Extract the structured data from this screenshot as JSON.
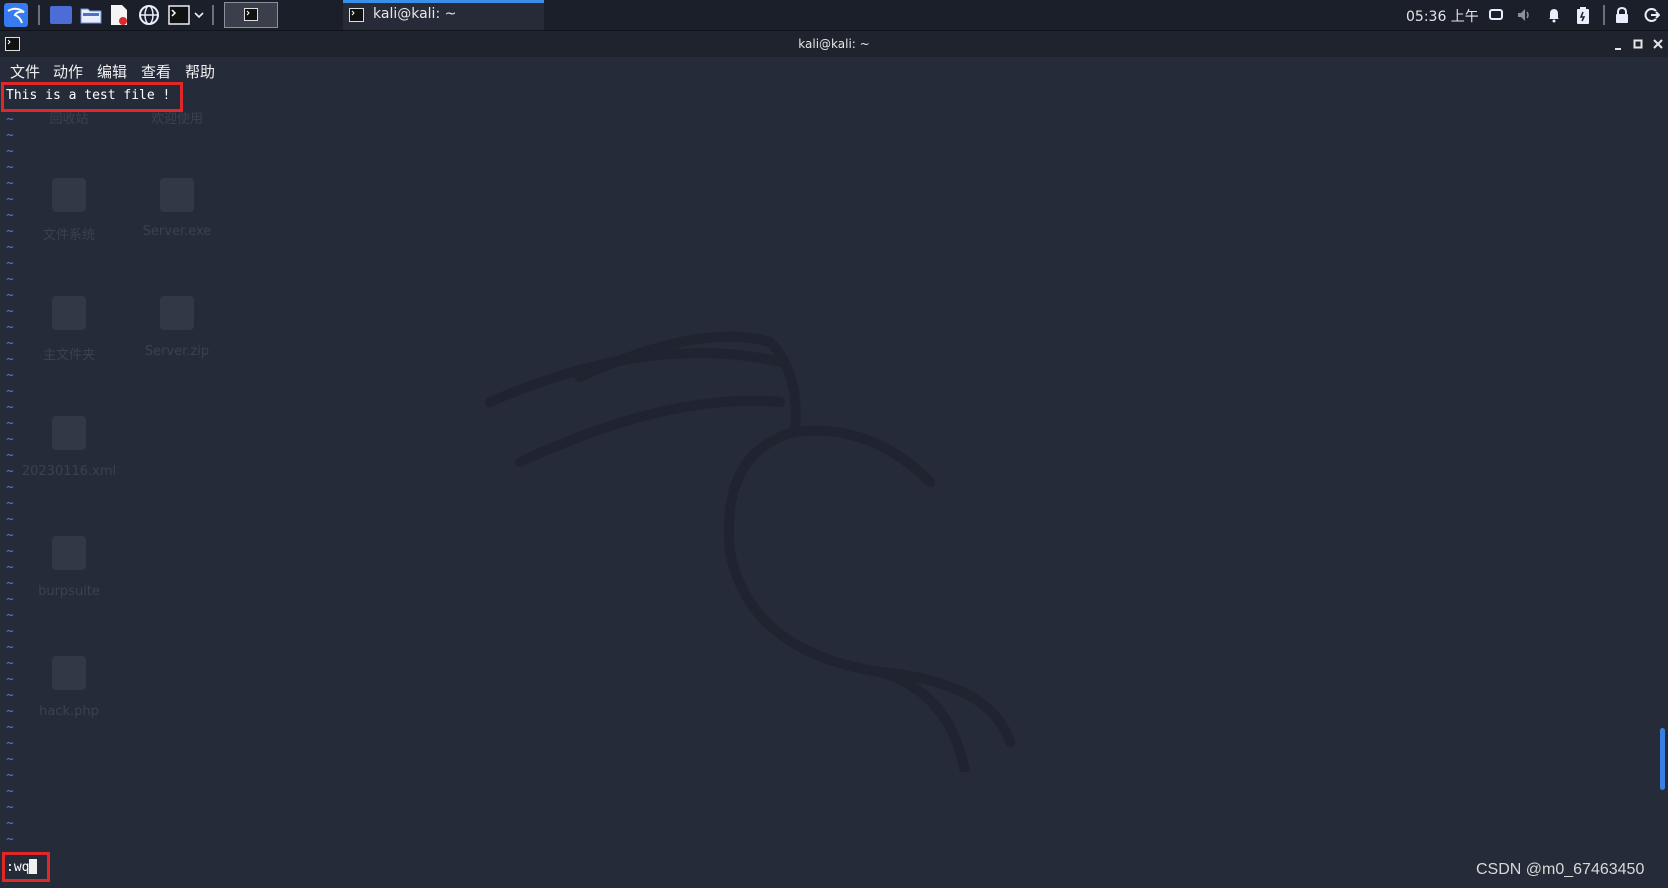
{
  "taskbar": {
    "window_button_label": "kali@kali: ~",
    "clock": "05:36 上午",
    "accent_color": "#3a8fe8"
  },
  "terminal": {
    "title": "kali@kali: ~",
    "menu": [
      "文件",
      "动作",
      "编辑",
      "查看",
      "帮助"
    ],
    "first_line": "This is a test file !",
    "empty_line_marker": "~",
    "command_line": ":wq",
    "highlight_color": "#e0282a"
  },
  "desktop_icons_faded": [
    "回收站",
    "欢迎使用",
    "文件系统",
    "Server.exe",
    "主文件夹",
    "Server.zip",
    "20230116.xml",
    "burpsuite",
    "hack.php"
  ],
  "watermark": "CSDN @m0_67463450"
}
